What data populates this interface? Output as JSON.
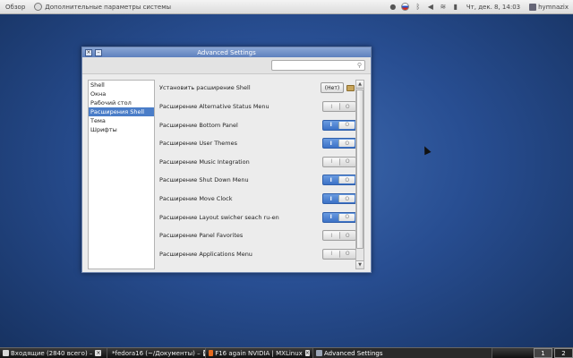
{
  "topbar": {
    "activities": "Обзор",
    "app_name": "Дополнительные параметры системы",
    "clock": "Чт, дек.  8, 14:03",
    "user": "hymnazix"
  },
  "window": {
    "title": "Advanced Settings",
    "search_placeholder": "",
    "sidebar": [
      "Shell",
      "Окна",
      "Рабочий стол",
      "Расширения Shell",
      "Тема",
      "Шрифты"
    ],
    "selected_sidebar": "Расширения Shell",
    "install_row": {
      "label": "Установить расширение Shell",
      "button": "(Нет)"
    },
    "toggle_on_glyph": "I",
    "toggle_off_glyph": "O",
    "extensions": [
      {
        "label": "Расширение Alternative Status Menu",
        "on": false
      },
      {
        "label": "Расширение Bottom Panel",
        "on": true
      },
      {
        "label": "Расширение User Themes",
        "on": true
      },
      {
        "label": "Расширение Music Integration",
        "on": false
      },
      {
        "label": "Расширение Shut Down Menu",
        "on": true
      },
      {
        "label": "Расширение Move Clock",
        "on": true
      },
      {
        "label": "Расширение Layout swicher seach ru-en",
        "on": true
      },
      {
        "label": "Расширение Panel Favorites",
        "on": false
      },
      {
        "label": "Расширение Applications Menu",
        "on": false
      }
    ]
  },
  "taskbar": {
    "tasks": [
      {
        "label": "Входящие (2840 всего) –",
        "color": "#d8d8d8"
      },
      {
        "label": "*fedora16 (~/Документы) –",
        "color": "#e8e8e8"
      },
      {
        "label": "F16 again NVIDIA | MXLinux",
        "color": "#e66a1f"
      },
      {
        "label": "Advanced Settings",
        "color": "#9aa4b4"
      }
    ],
    "workspaces": [
      "1",
      "2"
    ]
  }
}
